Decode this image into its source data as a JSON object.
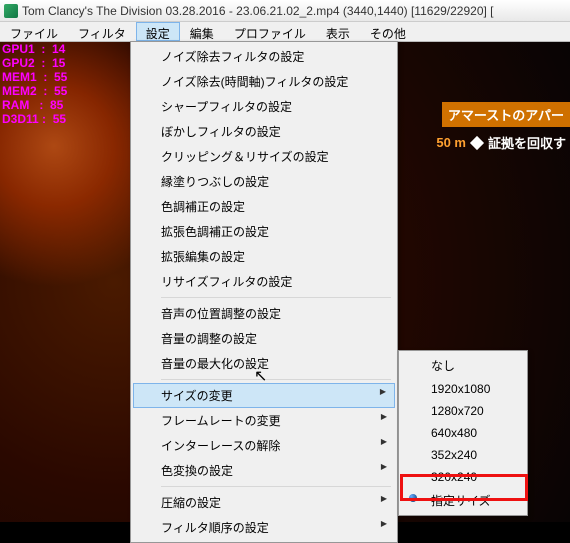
{
  "title": "Tom Clancy's The Division 03.28.2016 - 23.06.21.02_2.mp4 (3440,1440)  [11629/22920] [",
  "menubar": [
    "ファイル",
    "フィルタ",
    "設定",
    "編集",
    "プロファイル",
    "表示",
    "その他"
  ],
  "active_menu_index": 2,
  "stats": [
    {
      "k": "GPU1",
      "v": "14"
    },
    {
      "k": "GPU2",
      "v": "15"
    },
    {
      "k": "MEM1",
      "v": "55"
    },
    {
      "k": "MEM2",
      "v": "55"
    },
    {
      "k": "RAM",
      "v": "85"
    },
    {
      "k": "D3D11",
      "v": "55"
    }
  ],
  "hud": {
    "line1": "アマーストのアパー",
    "dist": "50 m",
    "line2": "証拠を回収す"
  },
  "menu1_groups": [
    [
      "ノイズ除去フィルタの設定",
      "ノイズ除去(時間軸)フィルタの設定",
      "シャープフィルタの設定",
      "ぼかしフィルタの設定",
      "クリッピング＆リサイズの設定",
      "縁塗りつぶしの設定",
      "色調補正の設定",
      "拡張色調補正の設定",
      "拡張編集の設定",
      "リサイズフィルタの設定"
    ],
    [
      "音声の位置調整の設定",
      "音量の調整の設定",
      "音量の最大化の設定"
    ],
    [
      "サイズの変更",
      "フレームレートの変更",
      "インターレースの解除",
      "色変換の設定"
    ],
    [
      "圧縮の設定",
      "フィルタ順序の設定"
    ]
  ],
  "menu1_subs": {
    "サイズの変更": 1,
    "フレームレートの変更": 1,
    "インターレースの解除": 1,
    "色変換の設定": 1,
    "圧縮の設定": 1,
    "フィルタ順序の設定": 1
  },
  "menu1_hover": "サイズの変更",
  "menu2": [
    "なし",
    "1920x1080",
    "1280x720",
    "640x480",
    "352x240",
    "320x240",
    "指定サイズ"
  ],
  "menu2_selected": "指定サイズ"
}
